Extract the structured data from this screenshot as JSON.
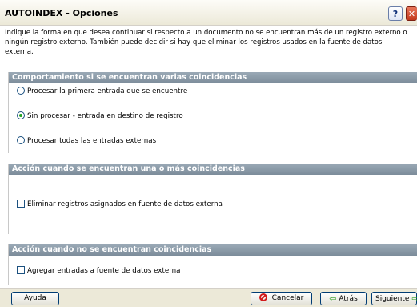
{
  "window": {
    "title": "AUTOINDEX - Opciones",
    "help_label": "?",
    "close_label": "✕"
  },
  "intro": {
    "line1": "Indique la forma en que desea continuar si respecto a un documento no se encuentran más de un registro externo o",
    "line2": "ningún registro externo. También puede decidir si hay que eliminar los registros usados en la fuente de datos externa."
  },
  "group1": {
    "header": "Comportamiento si se encuentran varias coincidencias",
    "options": [
      {
        "label": "Procesar la primera entrada que se encuentre",
        "selected": false
      },
      {
        "label": "Sin procesar - entrada en destino de registro",
        "selected": true
      },
      {
        "label": "Procesar todas las entradas externas",
        "selected": false
      }
    ]
  },
  "group2": {
    "header": "Acción cuando se encuentran una o más coincidencias",
    "checkbox": {
      "label": "Eliminar registros asignados en fuente de datos externa",
      "checked": false
    }
  },
  "group3": {
    "header": "Acción cuando no se encuentran coincidencias",
    "checkbox": {
      "label": "Agregar entradas a fuente de datos externa",
      "checked": false
    }
  },
  "footer": {
    "help": "Ayuda",
    "cancel": "Cancelar",
    "back": "Atrás",
    "next": "Siguiente"
  }
}
